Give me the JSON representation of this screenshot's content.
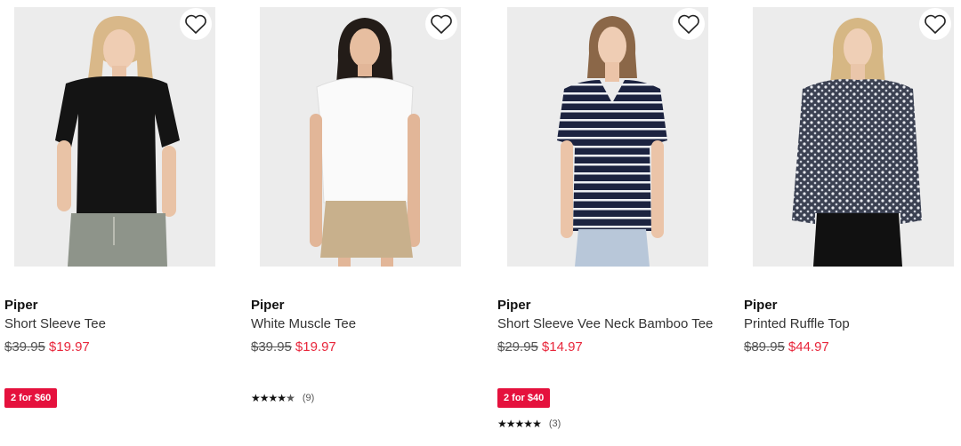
{
  "products": [
    {
      "brand": "Piper",
      "name": "Short Sleeve Tee",
      "was_price": "$39.95",
      "price": "$19.97",
      "promo": "2 for $60",
      "rating_count": "",
      "wishlist_icon": "heart-icon"
    },
    {
      "brand": "Piper",
      "name": "White Muscle Tee",
      "was_price": "$39.95",
      "price": "$19.97",
      "promo": "",
      "rating_count": "(9)",
      "rating_stars": 4.5,
      "wishlist_icon": "heart-icon"
    },
    {
      "brand": "Piper",
      "name": "Short Sleeve Vee Neck Bamboo Tee",
      "was_price": "$29.95",
      "price": "$14.97",
      "promo": "2 for $40",
      "rating_count": "(3)",
      "rating_stars": 5,
      "wishlist_icon": "heart-icon"
    },
    {
      "brand": "Piper",
      "name": "Printed Ruffle Top",
      "was_price": "$89.95",
      "price": "$44.97",
      "promo": "",
      "rating_count": "",
      "wishlist_icon": "heart-icon"
    }
  ],
  "colors": {
    "sale_price": "#e8263b",
    "promo_badge": "#e5113d",
    "image_background": "#ebebeb"
  }
}
